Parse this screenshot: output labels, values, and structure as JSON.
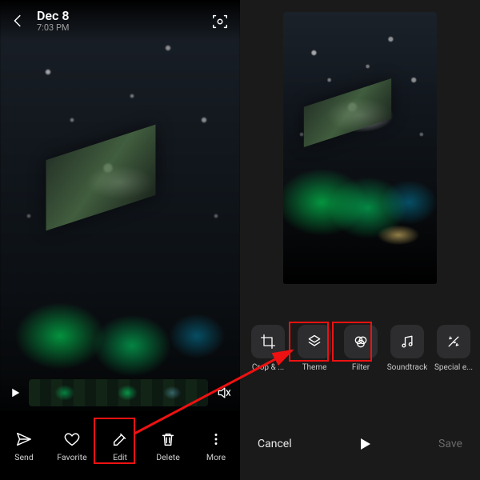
{
  "left": {
    "date": "Dec 8",
    "time": "7:03 PM",
    "actions": {
      "send": "Send",
      "favorite": "Favorite",
      "edit": "Edit",
      "delete": "Delete",
      "more": "More"
    }
  },
  "right": {
    "tools": {
      "crop": "Crop & ...",
      "theme": "Theme",
      "filter": "Filter",
      "soundtrack": "Soundtrack",
      "special": "Special e..."
    },
    "cancel": "Cancel",
    "save": "Save"
  },
  "colors": {
    "highlight": "#e11"
  }
}
